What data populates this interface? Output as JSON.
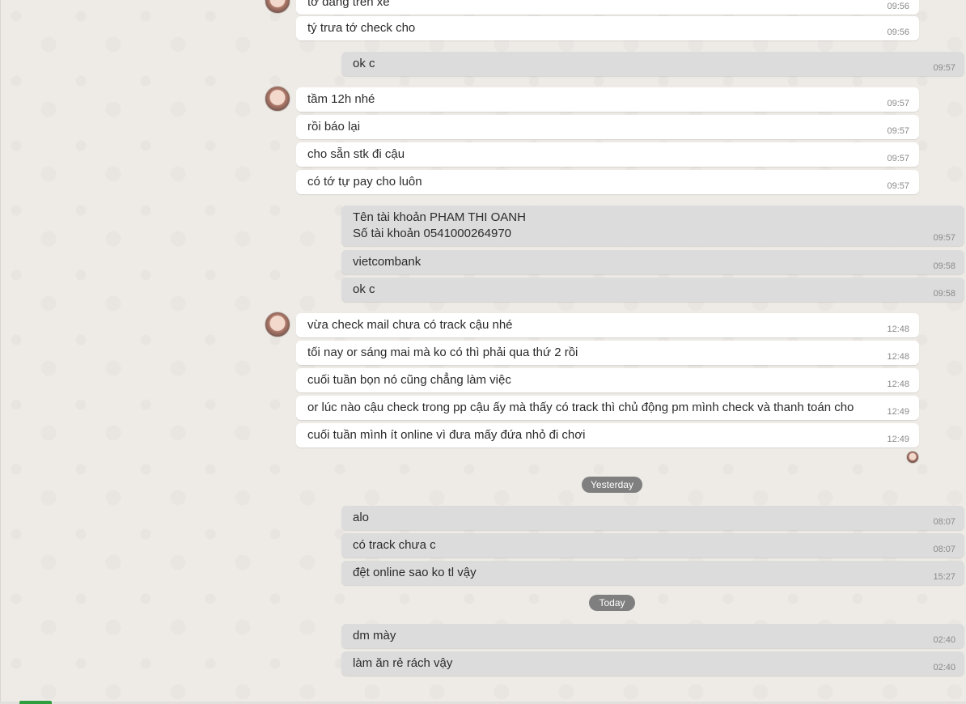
{
  "date_separators": {
    "yesterday": "Yesterday",
    "today": "Today"
  },
  "messages": [
    {
      "dir": "in",
      "text": "tớ đang trên xe",
      "time": "09:56"
    },
    {
      "dir": "in",
      "text": "tý trưa tớ check cho",
      "time": "09:56"
    },
    {
      "dir": "out",
      "text": "ok c",
      "time": "09:57"
    },
    {
      "dir": "in",
      "text": "tầm 12h nhé",
      "time": "09:57"
    },
    {
      "dir": "in",
      "text": "rồi báo lại",
      "time": "09:57"
    },
    {
      "dir": "in",
      "text": "cho sẵn stk đi cậu",
      "time": "09:57"
    },
    {
      "dir": "in",
      "text": "có tớ tự pay cho luôn",
      "time": "09:57"
    },
    {
      "dir": "out",
      "text": "Tên tài khoản PHAM THI OANH\nSố tài khoản 0541000264970",
      "time": "09:57"
    },
    {
      "dir": "out",
      "text": "vietcombank",
      "time": "09:58"
    },
    {
      "dir": "out",
      "text": "ok c",
      "time": "09:58"
    },
    {
      "dir": "in",
      "text": "vừa check mail chưa có track cậu nhé",
      "time": "12:48"
    },
    {
      "dir": "in",
      "text": "tối nay or sáng mai mà ko có thì phải qua thứ 2 rồi",
      "time": "12:48"
    },
    {
      "dir": "in",
      "text": "cuối tuần bọn nó cũng chẳng làm việc",
      "time": "12:48"
    },
    {
      "dir": "in",
      "text": "or lúc nào cậu check trong pp cậu ấy mà thấy có track thì chủ động pm mình check và thanh toán cho",
      "time": "12:49"
    },
    {
      "dir": "in",
      "text": "cuối tuần mình ít online vì đưa mấy đứa nhỏ đi chơi",
      "time": "12:49"
    },
    {
      "dir": "out",
      "text": "alo",
      "time": "08:07"
    },
    {
      "dir": "out",
      "text": "có track chưa c",
      "time": "08:07"
    },
    {
      "dir": "out",
      "text": "đệt online sao ko tl vậy",
      "time": "15:27"
    },
    {
      "dir": "out",
      "text": "dm mày",
      "time": "02:40"
    },
    {
      "dir": "out",
      "text": "làm ăn rẻ rách vậy",
      "time": "02:40"
    }
  ]
}
